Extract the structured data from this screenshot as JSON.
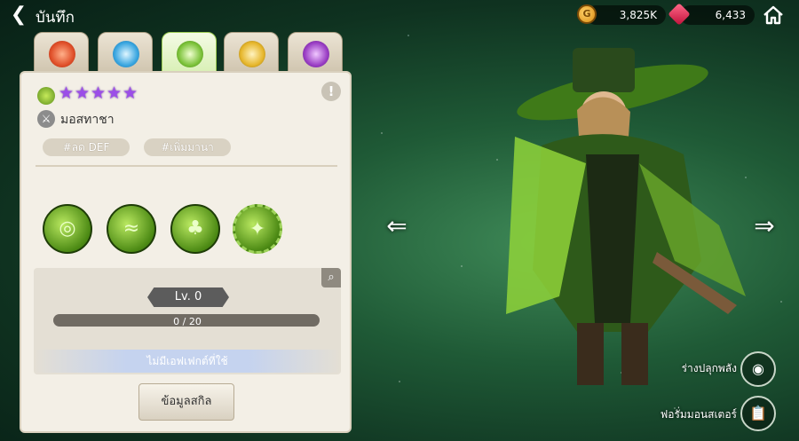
{
  "header": {
    "back_icon": "back-arrow-icon",
    "title": "บันทึก",
    "currencies": {
      "gold": {
        "icon": "gold-coin-icon",
        "value": "3,825K"
      },
      "gems": {
        "icon": "ruby-gem-icon",
        "value": "6,433"
      }
    },
    "home_icon": "home-icon"
  },
  "element_tabs": [
    {
      "icon": "fire-orb-icon",
      "color": "#e0502a",
      "active": false
    },
    {
      "icon": "water-orb-icon",
      "color": "#3aa6e0",
      "active": false
    },
    {
      "icon": "wind-orb-icon",
      "color": "#7cc23a",
      "active": true
    },
    {
      "icon": "light-orb-icon",
      "color": "#e6b62c",
      "active": false
    },
    {
      "icon": "dark-orb-icon",
      "color": "#9a3ec4",
      "active": false
    }
  ],
  "monster": {
    "element_icon": "wind-element-icon",
    "stars": 5,
    "star_color": "#9b4de8",
    "type_icon": "attack-type-icon",
    "name": "มอสทาชา",
    "tags": [
      "#ลด DEF",
      "#เพิ่มมานา"
    ]
  },
  "skills": [
    {
      "icon": "skill-1-icon"
    },
    {
      "icon": "skill-2-icon"
    },
    {
      "icon": "skill-3-icon"
    },
    {
      "icon": "skill-4-icon",
      "highlighted": true
    }
  ],
  "level": {
    "label": "Lv. 0",
    "progress_text": "0 / 20",
    "progress_current": 0,
    "progress_max": 20,
    "effect_text": "ไม่มีเอฟเฟกต์ที่ใช้"
  },
  "buttons": {
    "skill_info": "ข้อมูลสกิล",
    "info": "!",
    "zoom_icon": "magnifier-icon"
  },
  "side": {
    "left_arrow_icon": "left-arrow-icon",
    "right_arrow_icon": "right-arrow-icon",
    "awaken_label": "ร่างปลุกพลัง",
    "awaken_icon": "eye-icon",
    "forum_label": "ฟอรั่มมอนสเตอร์",
    "forum_icon": "clipboard-icon"
  },
  "colors": {
    "wind_green": "#7cc23a",
    "panel_bg": "#f3efe6"
  }
}
